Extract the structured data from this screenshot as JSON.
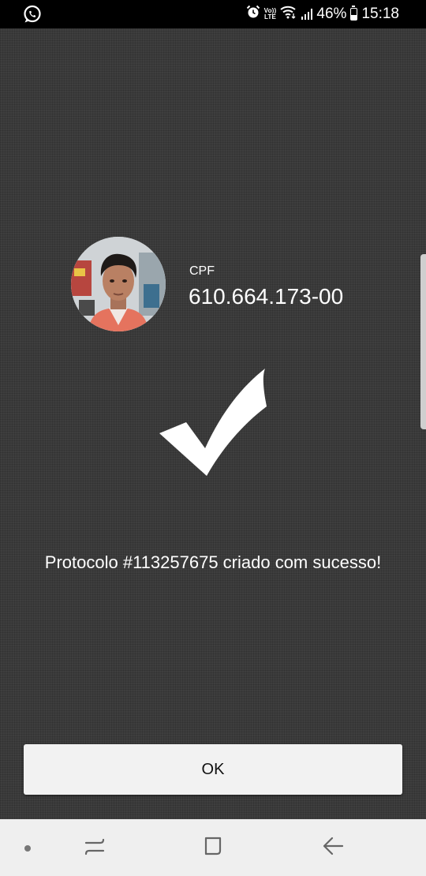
{
  "status_bar": {
    "battery": "46%",
    "time": "15:18",
    "volte_top": "Vo))",
    "volte_bottom": "LTE",
    "icons": [
      "whatsapp-icon",
      "alarm-icon",
      "volte-icon",
      "wifi-icon",
      "signal-icon",
      "battery-icon"
    ],
    "battery_level": 0.46
  },
  "profile": {
    "cpf_label": "CPF",
    "cpf_value": "610.664.173-00"
  },
  "result": {
    "icon": "checkmark-icon",
    "message": "Protocolo #113257675 criado com sucesso!"
  },
  "actions": {
    "ok_label": "OK"
  },
  "navigation": {
    "icons": [
      "dot-icon",
      "recent-apps-icon",
      "home-icon",
      "back-icon"
    ]
  },
  "colors": {
    "background": "#3e3e3e",
    "status_bar": "#000000",
    "nav_bar": "#efefef",
    "button": "#f2f2f2",
    "text": "#ffffff"
  }
}
